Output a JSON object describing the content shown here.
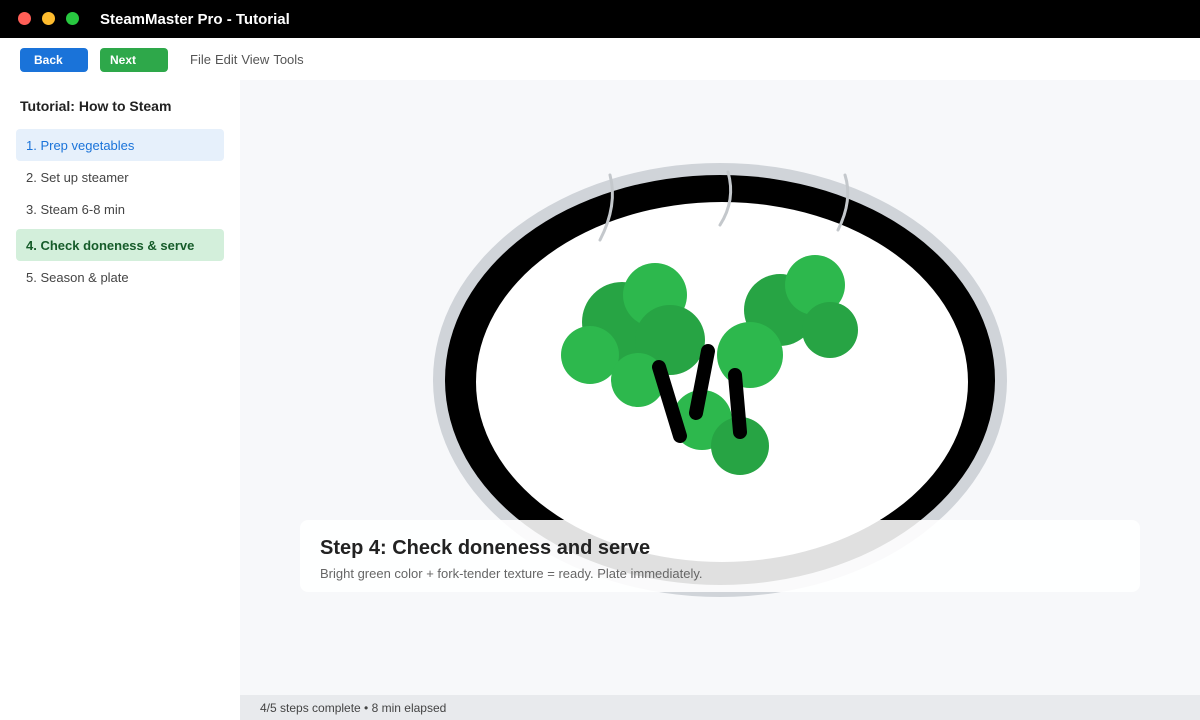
{
  "window": {
    "title": "SteamMaster Pro - Tutorial"
  },
  "toolbar": {
    "back_label": "Back",
    "next_label": "Next",
    "menu": [
      "File",
      "Edit",
      "View",
      "Tools"
    ]
  },
  "sidebar": {
    "title": "Tutorial: How to Steam",
    "steps": [
      {
        "label": "1. Prep vegetables"
      },
      {
        "label": "2. Set up steamer"
      },
      {
        "label": "3. Steam 6-8 min"
      },
      {
        "label": "4. Check doneness & serve"
      },
      {
        "label": "5. Season & plate"
      }
    ]
  },
  "caption": {
    "title": "Step 4: Check doneness and serve",
    "description": "Bright green color + fork-tender texture = ready. Plate immediately."
  },
  "status": {
    "text": "4/5 steps complete • 8 min elapsed"
  },
  "colors": {
    "broccoli_light": "#2db84d",
    "broccoli_dark": "#27a444",
    "plate_rim": "#000000",
    "plate_outer": "#d0d4d9",
    "accent_blue": "#1a73d9",
    "accent_green": "#2ea84a"
  }
}
